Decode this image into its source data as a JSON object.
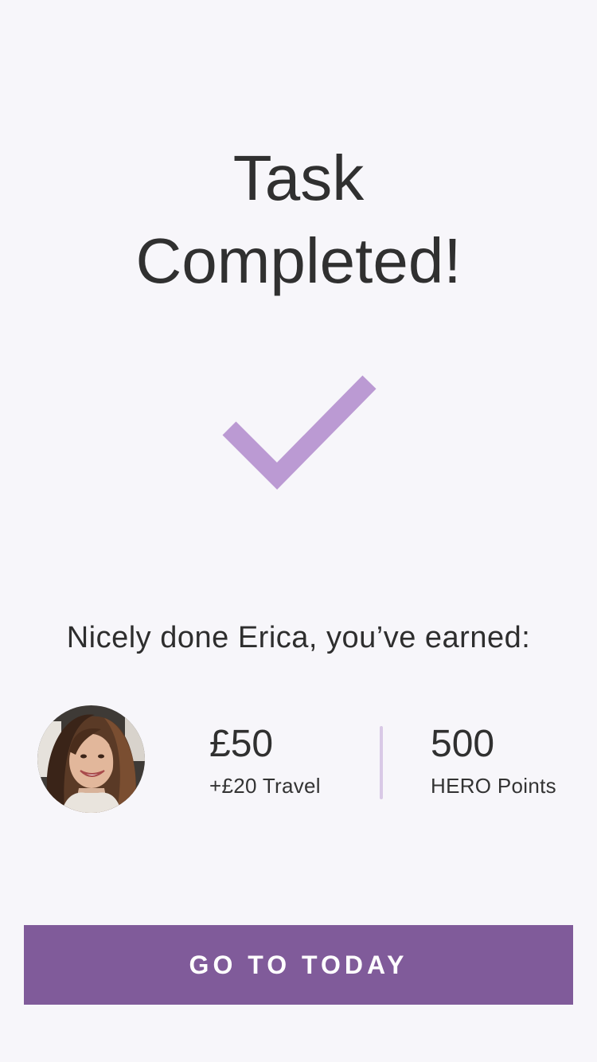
{
  "title": {
    "line1": "Task",
    "line2": "Completed!"
  },
  "icons": {
    "status": "checkmark-icon",
    "avatar": "user-avatar"
  },
  "colors": {
    "background": "#f7f6fa",
    "accent": "#805b9a",
    "checkmark": "#bb9ad3",
    "divider": "#d9c9e6",
    "text": "#303030"
  },
  "message": "Nicely done Erica, you’ve earned:",
  "earnings": {
    "money": {
      "value": "£50",
      "label": "+£20 Travel"
    },
    "points": {
      "value": "500",
      "label": "HERO Points"
    }
  },
  "cta": {
    "label": "GO TO TODAY"
  }
}
